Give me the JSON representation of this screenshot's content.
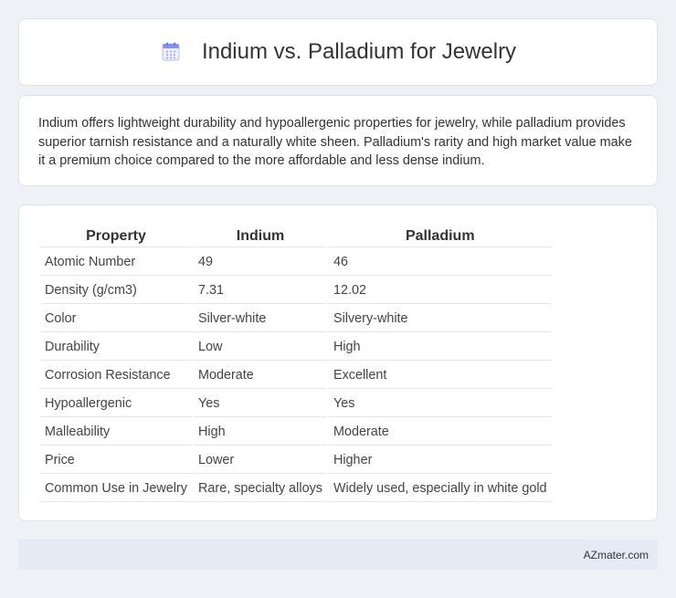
{
  "header": {
    "title": "Indium vs. Palladium for Jewelry",
    "icon": "calendar-icon"
  },
  "summary": {
    "text": "Indium offers lightweight durability and hypoallergenic properties for jewelry, while palladium provides superior tarnish resistance and a naturally white sheen. Palladium's rarity and high market value make it a premium choice compared to the more affordable and less dense indium."
  },
  "table": {
    "headers": [
      "Property",
      "Indium",
      "Palladium"
    ],
    "rows": [
      [
        "Atomic Number",
        "49",
        "46"
      ],
      [
        "Density (g/cm3)",
        "7.31",
        "12.02"
      ],
      [
        "Color",
        "Silver-white",
        "Silvery-white"
      ],
      [
        "Durability",
        "Low",
        "High"
      ],
      [
        "Corrosion Resistance",
        "Moderate",
        "Excellent"
      ],
      [
        "Hypoallergenic",
        "Yes",
        "Yes"
      ],
      [
        "Malleability",
        "High",
        "Moderate"
      ],
      [
        "Price",
        "Lower",
        "Higher"
      ],
      [
        "Common Use in Jewelry",
        "Rare, specialty alloys",
        "Widely used, especially in white gold"
      ]
    ]
  },
  "footer": {
    "text": "AZmater.com"
  },
  "colors": {
    "background": "#eef2f7",
    "card": "#ffffff",
    "footer": "#e4ebf5",
    "icon_accent": "#7b86e8"
  }
}
